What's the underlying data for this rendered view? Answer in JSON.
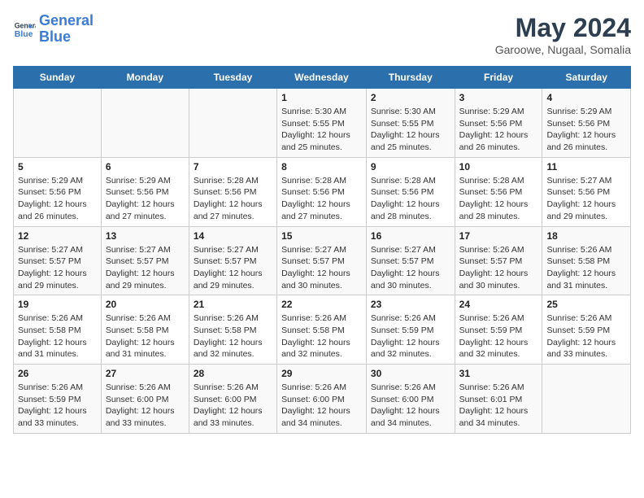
{
  "header": {
    "logo_line1": "General",
    "logo_line2": "Blue",
    "month_year": "May 2024",
    "location": "Garoowe, Nugaal, Somalia"
  },
  "days_of_week": [
    "Sunday",
    "Monday",
    "Tuesday",
    "Wednesday",
    "Thursday",
    "Friday",
    "Saturday"
  ],
  "weeks": [
    [
      {
        "day": "",
        "info": ""
      },
      {
        "day": "",
        "info": ""
      },
      {
        "day": "",
        "info": ""
      },
      {
        "day": "1",
        "info": "Sunrise: 5:30 AM\nSunset: 5:55 PM\nDaylight: 12 hours\nand 25 minutes."
      },
      {
        "day": "2",
        "info": "Sunrise: 5:30 AM\nSunset: 5:55 PM\nDaylight: 12 hours\nand 25 minutes."
      },
      {
        "day": "3",
        "info": "Sunrise: 5:29 AM\nSunset: 5:56 PM\nDaylight: 12 hours\nand 26 minutes."
      },
      {
        "day": "4",
        "info": "Sunrise: 5:29 AM\nSunset: 5:56 PM\nDaylight: 12 hours\nand 26 minutes."
      }
    ],
    [
      {
        "day": "5",
        "info": "Sunrise: 5:29 AM\nSunset: 5:56 PM\nDaylight: 12 hours\nand 26 minutes."
      },
      {
        "day": "6",
        "info": "Sunrise: 5:29 AM\nSunset: 5:56 PM\nDaylight: 12 hours\nand 27 minutes."
      },
      {
        "day": "7",
        "info": "Sunrise: 5:28 AM\nSunset: 5:56 PM\nDaylight: 12 hours\nand 27 minutes."
      },
      {
        "day": "8",
        "info": "Sunrise: 5:28 AM\nSunset: 5:56 PM\nDaylight: 12 hours\nand 27 minutes."
      },
      {
        "day": "9",
        "info": "Sunrise: 5:28 AM\nSunset: 5:56 PM\nDaylight: 12 hours\nand 28 minutes."
      },
      {
        "day": "10",
        "info": "Sunrise: 5:28 AM\nSunset: 5:56 PM\nDaylight: 12 hours\nand 28 minutes."
      },
      {
        "day": "11",
        "info": "Sunrise: 5:27 AM\nSunset: 5:56 PM\nDaylight: 12 hours\nand 29 minutes."
      }
    ],
    [
      {
        "day": "12",
        "info": "Sunrise: 5:27 AM\nSunset: 5:57 PM\nDaylight: 12 hours\nand 29 minutes."
      },
      {
        "day": "13",
        "info": "Sunrise: 5:27 AM\nSunset: 5:57 PM\nDaylight: 12 hours\nand 29 minutes."
      },
      {
        "day": "14",
        "info": "Sunrise: 5:27 AM\nSunset: 5:57 PM\nDaylight: 12 hours\nand 29 minutes."
      },
      {
        "day": "15",
        "info": "Sunrise: 5:27 AM\nSunset: 5:57 PM\nDaylight: 12 hours\nand 30 minutes."
      },
      {
        "day": "16",
        "info": "Sunrise: 5:27 AM\nSunset: 5:57 PM\nDaylight: 12 hours\nand 30 minutes."
      },
      {
        "day": "17",
        "info": "Sunrise: 5:26 AM\nSunset: 5:57 PM\nDaylight: 12 hours\nand 30 minutes."
      },
      {
        "day": "18",
        "info": "Sunrise: 5:26 AM\nSunset: 5:58 PM\nDaylight: 12 hours\nand 31 minutes."
      }
    ],
    [
      {
        "day": "19",
        "info": "Sunrise: 5:26 AM\nSunset: 5:58 PM\nDaylight: 12 hours\nand 31 minutes."
      },
      {
        "day": "20",
        "info": "Sunrise: 5:26 AM\nSunset: 5:58 PM\nDaylight: 12 hours\nand 31 minutes."
      },
      {
        "day": "21",
        "info": "Sunrise: 5:26 AM\nSunset: 5:58 PM\nDaylight: 12 hours\nand 32 minutes."
      },
      {
        "day": "22",
        "info": "Sunrise: 5:26 AM\nSunset: 5:58 PM\nDaylight: 12 hours\nand 32 minutes."
      },
      {
        "day": "23",
        "info": "Sunrise: 5:26 AM\nSunset: 5:59 PM\nDaylight: 12 hours\nand 32 minutes."
      },
      {
        "day": "24",
        "info": "Sunrise: 5:26 AM\nSunset: 5:59 PM\nDaylight: 12 hours\nand 32 minutes."
      },
      {
        "day": "25",
        "info": "Sunrise: 5:26 AM\nSunset: 5:59 PM\nDaylight: 12 hours\nand 33 minutes."
      }
    ],
    [
      {
        "day": "26",
        "info": "Sunrise: 5:26 AM\nSunset: 5:59 PM\nDaylight: 12 hours\nand 33 minutes."
      },
      {
        "day": "27",
        "info": "Sunrise: 5:26 AM\nSunset: 6:00 PM\nDaylight: 12 hours\nand 33 minutes."
      },
      {
        "day": "28",
        "info": "Sunrise: 5:26 AM\nSunset: 6:00 PM\nDaylight: 12 hours\nand 33 minutes."
      },
      {
        "day": "29",
        "info": "Sunrise: 5:26 AM\nSunset: 6:00 PM\nDaylight: 12 hours\nand 34 minutes."
      },
      {
        "day": "30",
        "info": "Sunrise: 5:26 AM\nSunset: 6:00 PM\nDaylight: 12 hours\nand 34 minutes."
      },
      {
        "day": "31",
        "info": "Sunrise: 5:26 AM\nSunset: 6:01 PM\nDaylight: 12 hours\nand 34 minutes."
      },
      {
        "day": "",
        "info": ""
      }
    ]
  ]
}
